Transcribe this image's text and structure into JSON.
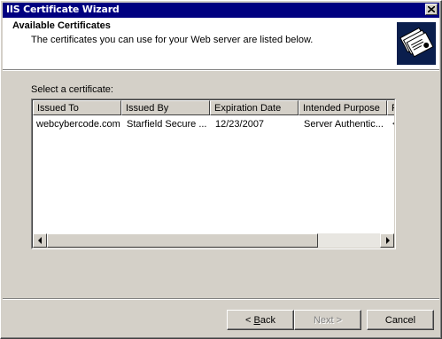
{
  "window": {
    "title": "IIS Certificate Wizard"
  },
  "header": {
    "title": "Available Certificates",
    "subtitle": "The certificates you can use for your Web server are listed below."
  },
  "list": {
    "label": "Select a certificate:",
    "columns": [
      "Issued To",
      "Issued By",
      "Expiration Date",
      "Intended Purpose",
      "F"
    ],
    "rows": [
      {
        "issued_to": "webcybercode.com",
        "issued_by": "Starfield Secure ...",
        "expiration": "12/23/2007",
        "purpose": "Server Authentic...",
        "extra": "<"
      }
    ]
  },
  "buttons": {
    "back": {
      "prefix": "< ",
      "hotkey": "B",
      "rest": "ack"
    },
    "next": {
      "label": "Next >"
    },
    "cancel": {
      "label": "Cancel"
    }
  },
  "icons": {
    "close": "close-icon",
    "certificate": "certificate-icon",
    "scroll_left": "arrow-left-icon",
    "scroll_right": "arrow-right-icon"
  }
}
